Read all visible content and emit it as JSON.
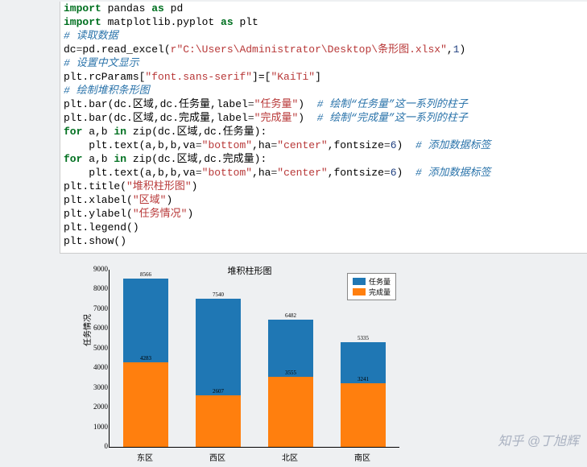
{
  "code": {
    "l1_a": "import",
    "l1_b": " pandas ",
    "l1_c": "as",
    "l1_d": " pd",
    "l2_a": "import",
    "l2_b": " matplotlib.pyplot ",
    "l2_c": "as",
    "l2_d": " plt",
    "l3": "# 读取数据",
    "l4_a": "dc",
    "l4_b": "=",
    "l4_c": "pd.read_excel(",
    "l4_d": "r\"C:\\Users\\Administrator\\Desktop\\条形图.xlsx\"",
    "l4_e": ",",
    "l4_f": "1",
    "l4_g": ")",
    "l5": "# 设置中文显示",
    "l6_a": "plt.rcParams[",
    "l6_b": "\"font.sans-serif\"",
    "l6_c": "]=[",
    "l6_d": "\"KaiTi\"",
    "l6_e": "]",
    "l7": "# 绘制堆积条形图",
    "l8_a": "plt.bar(dc.区域,dc.任务量,label",
    "l8_b": "=",
    "l8_c": "\"任务量\"",
    "l8_d": ")  ",
    "l8_e": "# 绘制“任务量”这一系列的柱子",
    "l9_a": "plt.bar(dc.区域,dc.完成量,label",
    "l9_b": "=",
    "l9_c": "\"完成量\"",
    "l9_d": ")  ",
    "l9_e": "# 绘制“完成量”这一系列的柱子",
    "l10_a": "for",
    "l10_b": " a,b ",
    "l10_c": "in",
    "l10_d": " ",
    "l10_e": "zip",
    "l10_f": "(dc.区域,dc.任务量):",
    "l11_a": "    plt.text(a,b,b,va",
    "l11_b": "=",
    "l11_c": "\"bottom\"",
    "l11_d": ",ha",
    "l11_e": "=",
    "l11_f": "\"center\"",
    "l11_g": ",fontsize",
    "l11_h": "=",
    "l11_i": "6",
    "l11_j": ")  ",
    "l11_k": "# 添加数据标签",
    "l12_a": "for",
    "l12_b": " a,b ",
    "l12_c": "in",
    "l12_d": " ",
    "l12_e": "zip",
    "l12_f": "(dc.区域,dc.完成量):",
    "l13_a": "    plt.text(a,b,b,va",
    "l13_b": "=",
    "l13_c": "\"bottom\"",
    "l13_d": ",ha",
    "l13_e": "=",
    "l13_f": "\"center\"",
    "l13_g": ",fontsize",
    "l13_h": "=",
    "l13_i": "6",
    "l13_j": ")  ",
    "l13_k": "# 添加数据标签",
    "l14_a": "plt.title(",
    "l14_b": "\"堆积柱形图\"",
    "l14_c": ")",
    "l15_a": "plt.xlabel(",
    "l15_b": "\"区域\"",
    "l15_c": ")",
    "l16_a": "plt.ylabel(",
    "l16_b": "\"任务情况\"",
    "l16_c": ")",
    "l17": "plt.legend()",
    "l18": "plt.show()"
  },
  "chart_data": {
    "type": "bar",
    "title": "堆积柱形图",
    "xlabel": "区域",
    "ylabel": "任务情况",
    "categories": [
      "东区",
      "西区",
      "北区",
      "南区"
    ],
    "series": [
      {
        "name": "任务量",
        "color": "#1f77b4",
        "values": [
          8566,
          7540,
          6482,
          5335
        ]
      },
      {
        "name": "完成量",
        "color": "#ff7f0e",
        "values": [
          4283,
          2607,
          3555,
          3241
        ]
      }
    ],
    "ylim": [
      0,
      9000
    ],
    "yticks": [
      0,
      1000,
      2000,
      3000,
      4000,
      5000,
      6000,
      7000,
      8000,
      9000
    ],
    "legend_position": "upper right"
  },
  "watermark": "知乎 @丁旭辉"
}
